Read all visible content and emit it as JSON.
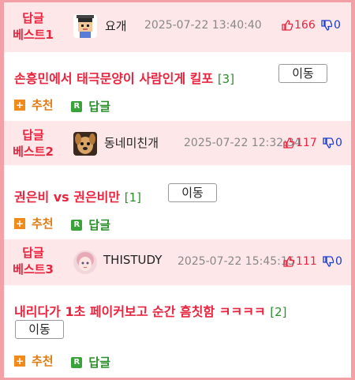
{
  "colors": {
    "border": "#f3a1a6",
    "header_bg": "#fde7e9",
    "accent_red": "#e8243e",
    "comment_green": "#2a8f2a",
    "downvote_blue": "#1a3bd1"
  },
  "posts": [
    {
      "badge_line1": "답글",
      "badge_line2": "베스트1",
      "author": "요개",
      "avatar_icon": "pixel-character-avatar",
      "date": "2025-07-22 13:40:40",
      "upvotes": "166",
      "downvotes": "0",
      "title": "손흥민에서 태극문양이 사람인게 킬포",
      "comment_count": "[3]",
      "move_label": "이동",
      "recommend_label": "추천",
      "reply_label": "답글"
    },
    {
      "badge_line1": "답글",
      "badge_line2": "베스트2",
      "author": "동네미친개",
      "avatar_icon": "dog-avatar",
      "date": "2025-07-22 12:32:34",
      "upvotes": "117",
      "downvotes": "0",
      "title": "권은비 vs 권은비만",
      "comment_count": "[1]",
      "move_label": "이동",
      "recommend_label": "추천",
      "reply_label": "답글"
    },
    {
      "badge_line1": "답글",
      "badge_line2": "베스트3",
      "author": "THISTUDY",
      "avatar_icon": "anime-girl-avatar",
      "date": "2025-07-22 15:45:15",
      "upvotes": "111",
      "downvotes": "0",
      "title": "내리다가 1초 페이커보고 순간 흠칫함 ㅋㅋㅋㅋ",
      "comment_count": "[2]",
      "move_label": "이동",
      "recommend_label": "추천",
      "reply_label": "답글"
    }
  ]
}
